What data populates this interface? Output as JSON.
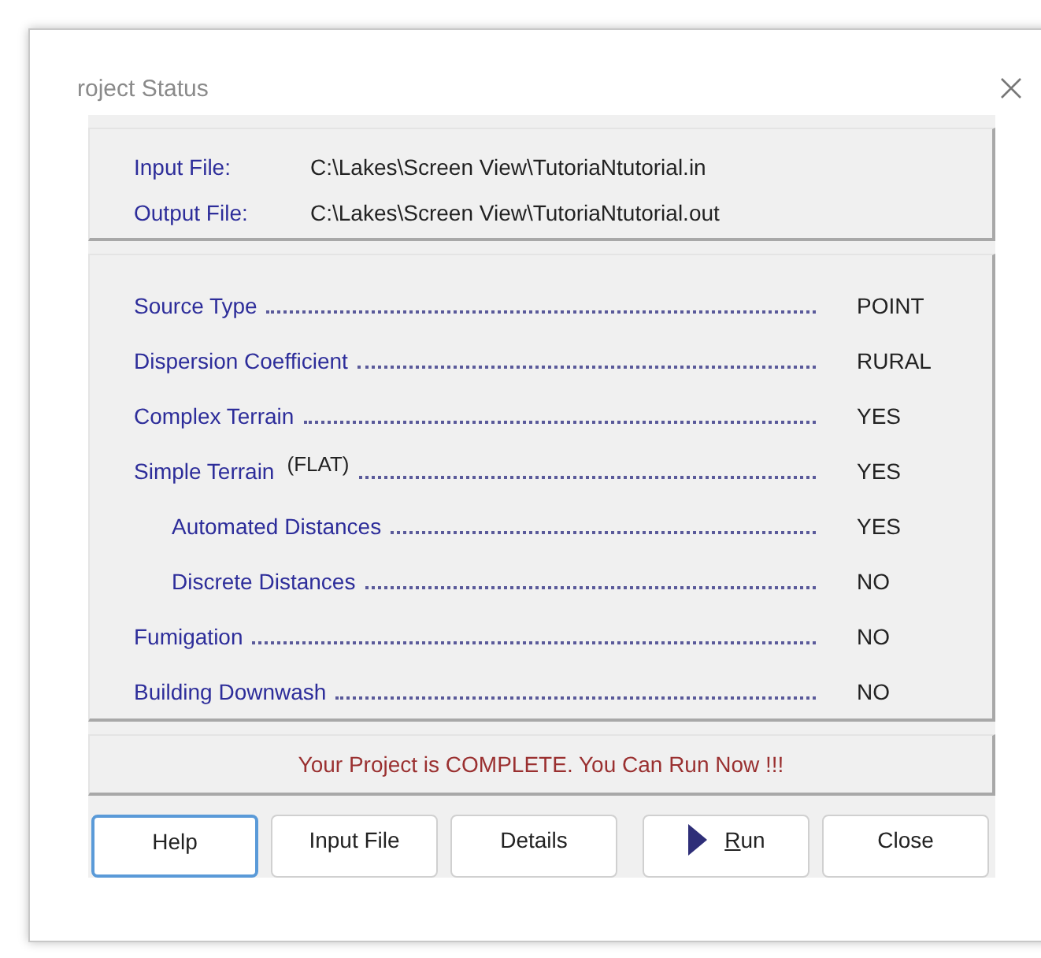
{
  "window": {
    "title": "roject Status"
  },
  "files": [
    {
      "label": "Input File:",
      "value": "C:\\Lakes\\Screen View\\TutoriaNtutorial.in"
    },
    {
      "label": "Output File:",
      "value": "C:\\Lakes\\Screen View\\TutoriaNtutorial.out"
    }
  ],
  "items": [
    {
      "label": "Source Type",
      "value": "POINT"
    },
    {
      "label": "Dispersion Coefficient",
      "value": "RURAL"
    },
    {
      "label": "Complex Terrain",
      "value": "YES"
    },
    {
      "label": "Simple Terrain",
      "note": "(FLAT)",
      "value": "YES",
      "children": [
        {
          "label": "Automated Distances",
          "value": "YES"
        },
        {
          "label": "Discrete Distances",
          "value": "NO"
        }
      ]
    },
    {
      "label": "Fumigation",
      "value": "NO"
    },
    {
      "label": "Building Downwash",
      "value": "NO"
    }
  ],
  "status": "Your Project is COMPLETE.  You Can Run Now !!!",
  "buttons": [
    {
      "label": "Help",
      "selected": true
    },
    {
      "label": "Input File",
      "selected": false
    },
    {
      "label": "Details",
      "selected": false
    },
    {
      "label": "Run",
      "selected": false,
      "kind": "run",
      "underline_first": true
    },
    {
      "label": "Close",
      "selected": false
    }
  ]
}
